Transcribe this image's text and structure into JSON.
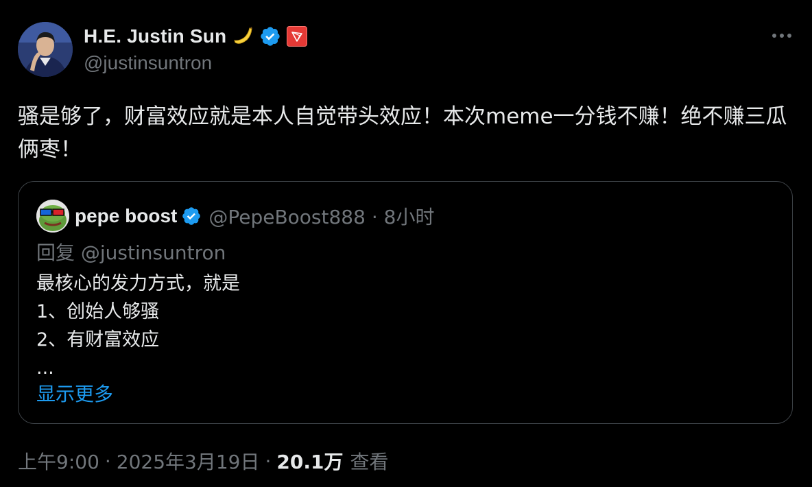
{
  "author": {
    "display_name": "H.E. Justin Sun",
    "handle": "@justinsuntron",
    "verified": true,
    "name_emoji": "banana-icon",
    "badge": "tron-logo-icon"
  },
  "tweet": {
    "text": "骚是够了，财富效应就是本人自觉带头效应！本次meme一分钱不赚！绝不赚三瓜俩枣！"
  },
  "quoted_tweet": {
    "display_name": "pepe boost",
    "handle": "@PepeBoost888",
    "separator": "·",
    "time_ago": "8小时",
    "reply_to": "回复 @justinsuntron",
    "body_lines": [
      "最核心的发力方式，就是",
      "1、创始人够骚",
      "2、有财富效应",
      "..."
    ],
    "show_more": "显示更多"
  },
  "footer": {
    "time": "上午9:00",
    "separator": "·",
    "date": "2025年3月19日",
    "views_count": "20.1万",
    "views_label": "查看"
  },
  "colors": {
    "background": "#000000",
    "text_primary": "#e7e9ea",
    "text_secondary": "#71767b",
    "accent_blue": "#1d9bf0",
    "border": "#3d4247",
    "tron_red": "#e53935"
  }
}
